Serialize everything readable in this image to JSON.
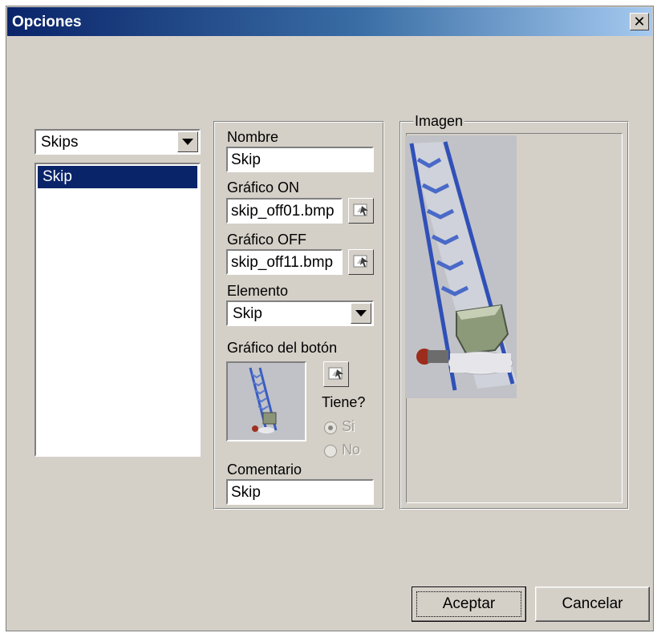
{
  "window": {
    "title": "Opciones"
  },
  "category_combo": {
    "value": "Skips"
  },
  "item_list": {
    "items": [
      "Skip"
    ]
  },
  "form": {
    "nombre_label": "Nombre",
    "nombre_value": "Skip",
    "grafico_on_label": "Gráfico ON",
    "grafico_on_value": "skip_off01.bmp",
    "grafico_off_label": "Gráfico OFF",
    "grafico_off_value": "skip_off11.bmp",
    "elemento_label": "Elemento",
    "elemento_value": "Skip",
    "grafico_boton_label": "Gráfico del botón",
    "tiene_label": "Tiene?",
    "si_label": "Si",
    "no_label": "No",
    "comentario_label": "Comentario",
    "comentario_value": "Skip"
  },
  "imagen": {
    "legend": "Imagen"
  },
  "buttons": {
    "aceptar": "Aceptar",
    "cancelar": "Cancelar"
  },
  "colors": {
    "title_active": "#0a246a",
    "face": "#d4d0c8",
    "selection": "#0a246a"
  }
}
